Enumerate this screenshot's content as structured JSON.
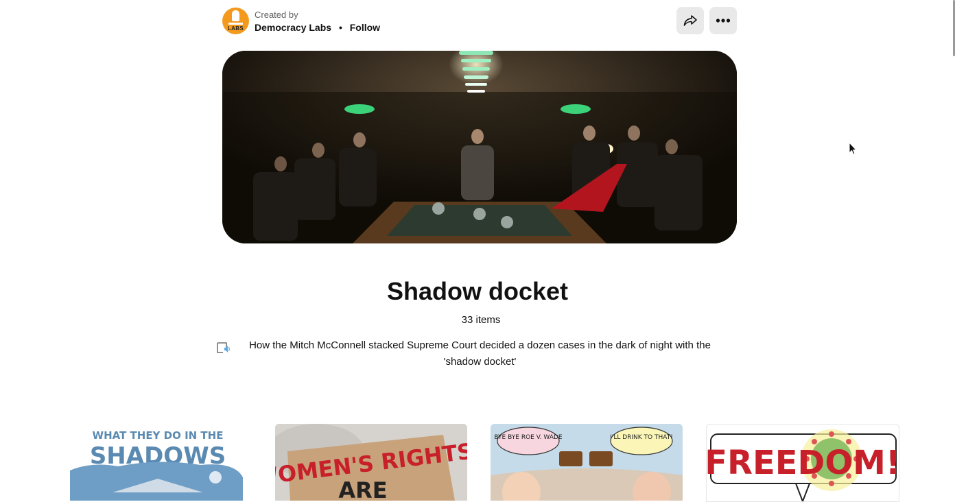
{
  "creator": {
    "created_by_label": "Created by",
    "name": "Democracy Labs",
    "separator": "•",
    "follow_label": "Follow",
    "avatar_text": "LABS"
  },
  "actions": {
    "share_icon": "share-arrow-icon",
    "more_icon": "ellipsis-icon"
  },
  "board": {
    "title": "Shadow docket",
    "item_count": "33 items",
    "description": "How the Mitch McConnell stacked Supreme Court decided a dozen cases in the dark of night with the 'shadow docket'"
  },
  "cards": [
    {
      "line1": "WHAT THEY DO IN THE",
      "line2": "SHADOWS"
    },
    {
      "line1": "WOMEN'S RIGHTS",
      "line2": "ARE"
    },
    {
      "bubble_left": "BYE BYE ROE V. WADE",
      "bubble_right": "I'LL DRINK TO THAT!"
    },
    {
      "text": "FREEDOM!"
    }
  ],
  "colors": {
    "avatar": "#f39a1e",
    "button_bg": "#e9e9e9",
    "hero_bg": "#0d0a06",
    "lamp_green": "#3cd27a",
    "freedom_red": "#c8202a"
  }
}
